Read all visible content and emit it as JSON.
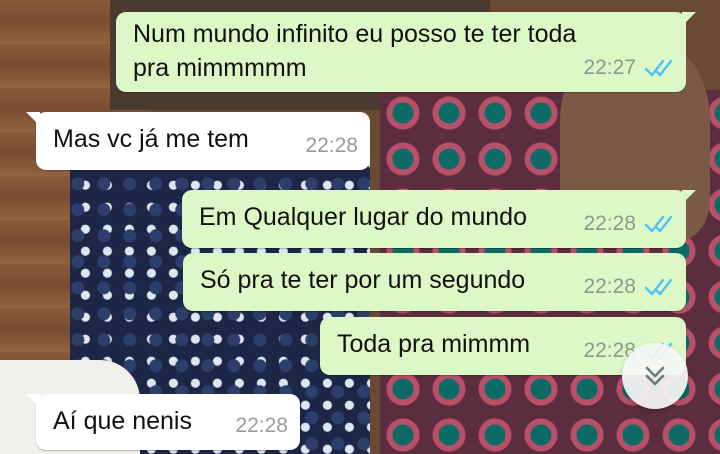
{
  "colors": {
    "outgoing_bubble": "#dcf8c6",
    "incoming_bubble": "#ffffff",
    "read_ticks": "#4fc3f7"
  },
  "messages": [
    {
      "direction": "outgoing",
      "text_line1": "Num mundo infinito eu posso te ter toda",
      "text_line2": "pra mimmmmm",
      "time": "22:27",
      "status": "read"
    },
    {
      "direction": "incoming",
      "text": "Mas vc já me tem",
      "time": "22:28"
    },
    {
      "direction": "outgoing",
      "text": "Em Qualquer lugar do mundo",
      "time": "22:28",
      "status": "read"
    },
    {
      "direction": "outgoing",
      "text": "Só pra te ter por um segundo",
      "time": "22:28",
      "status": "read"
    },
    {
      "direction": "outgoing",
      "text": "Toda pra mimmm",
      "time": "22:28",
      "status": "read"
    },
    {
      "direction": "incoming",
      "text": "Aí que nenis",
      "time": "22:28"
    }
  ],
  "scroll_button_icon": "double-chevron-down-icon"
}
